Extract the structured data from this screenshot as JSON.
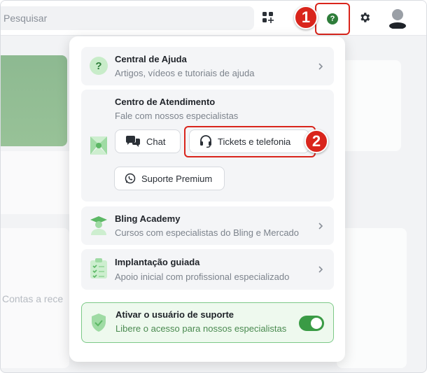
{
  "colors": {
    "accent_green": "#2e7d3a",
    "highlight_red": "#d9251c",
    "toggle_on": "#3a9b45"
  },
  "topbar": {
    "search_placeholder": "Pesquisar",
    "icons": [
      "apps-icon",
      "help-icon",
      "gear-icon",
      "avatar"
    ]
  },
  "background": {
    "texts": [
      "Contas a rece"
    ]
  },
  "badges": [
    "1",
    "2"
  ],
  "help_menu": {
    "central_ajuda": {
      "title": "Central de Ajuda",
      "subtitle": "Artigos, vídeos e tutoriais de ajuda"
    },
    "atendimento": {
      "title": "Centro de Atendimento",
      "subtitle": "Fale com nossos especialistas",
      "chat_label": "Chat",
      "tickets_label": "Tickets e telefonia",
      "premium_label": "Suporte Premium"
    },
    "academy": {
      "title": "Bling Academy",
      "subtitle": "Cursos com especialistas do Bling e Mercado"
    },
    "implantacao": {
      "title": "Implantação guiada",
      "subtitle": "Apoio inicial com profissional especializado"
    },
    "suporte_toggle": {
      "title": "Ativar o usuário de suporte",
      "subtitle": "Libere o acesso para nossos especialistas",
      "enabled": true
    }
  }
}
